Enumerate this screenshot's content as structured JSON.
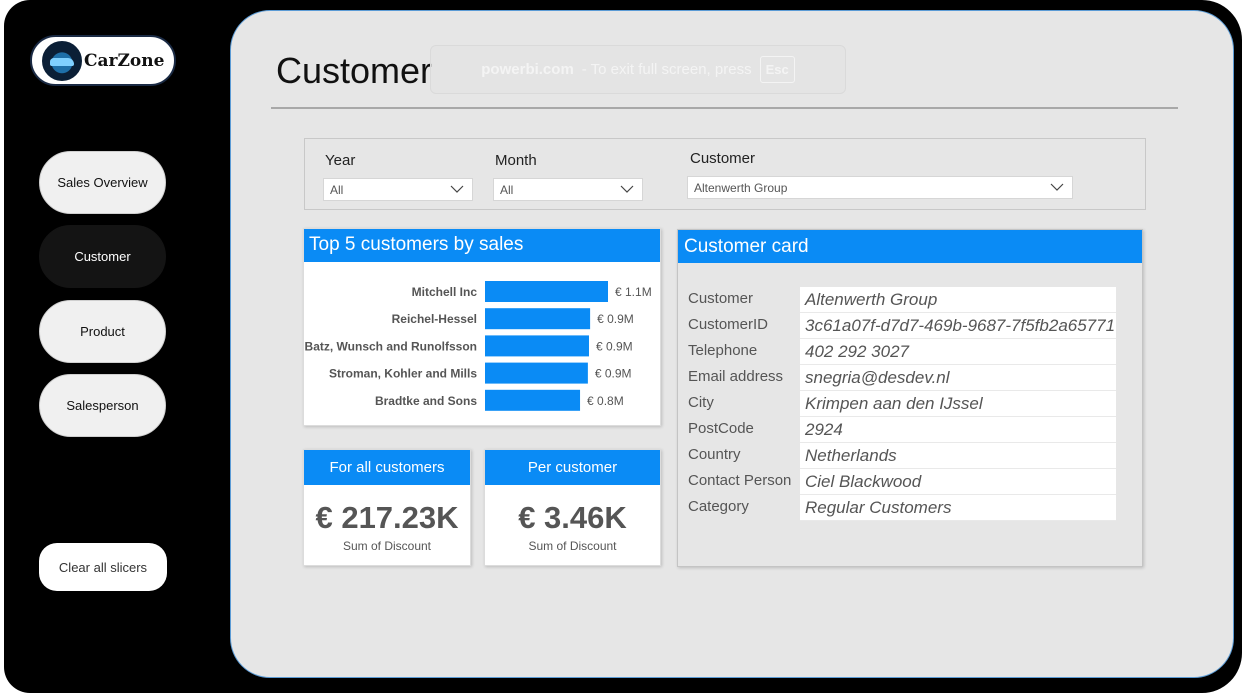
{
  "brand": {
    "name": "CarZone"
  },
  "nav": {
    "items": [
      {
        "label": "Sales Overview"
      },
      {
        "label": "Customer"
      },
      {
        "label": "Product"
      },
      {
        "label": "Salesperson"
      }
    ],
    "clear_label": "Clear all slicers"
  },
  "page": {
    "title": "Customer"
  },
  "fullscreen_toast": {
    "site": "powerbi.com",
    "message": "-  To exit full screen, press",
    "key": "Esc"
  },
  "filters": {
    "year": {
      "label": "Year",
      "value": "All"
    },
    "month": {
      "label": "Month",
      "value": "All"
    },
    "customer": {
      "label": "Customer",
      "value": "Altenwerth Group"
    }
  },
  "top5": {
    "title": "Top 5 customers by sales",
    "bar_color": "#0a8bf5",
    "chart_data": {
      "type": "bar",
      "orientation": "horizontal",
      "categories": [
        "Mitchell Inc",
        "Reichel-Hessel",
        "Batz, Wunsch and Runolfsson",
        "Stroman, Kohler and Mills",
        "Bradtke and Sons"
      ],
      "values": [
        1.1,
        0.94,
        0.93,
        0.92,
        0.85
      ],
      "labels": [
        "€ 1.1M",
        "€ 0.9M",
        "€ 0.9M",
        "€ 0.9M",
        "€ 0.8M"
      ],
      "unit": "€ M",
      "xlim": [
        0,
        1.1
      ]
    }
  },
  "kpis": [
    {
      "title": "For all customers",
      "value": "€ 217.23K",
      "subtitle": "Sum of Discount"
    },
    {
      "title": "Per customer",
      "value": "€ 3.46K",
      "subtitle": "Sum of Discount"
    }
  ],
  "customer_card": {
    "title": "Customer card",
    "rows": [
      {
        "label": "Customer",
        "value": "Altenwerth Group"
      },
      {
        "label": "CustomerID",
        "value": "3c61a07f-d7d7-469b-9687-7f5fb2a65771"
      },
      {
        "label": "Telephone",
        "value": "402 292 3027"
      },
      {
        "label": "Email address",
        "value": "snegria@desdev.nl"
      },
      {
        "label": "City",
        "value": "Krimpen aan den IJssel"
      },
      {
        "label": "PostCode",
        "value": "2924"
      },
      {
        "label": "Country",
        "value": "Netherlands"
      },
      {
        "label": "Contact Person",
        "value": "Ciel Blackwood"
      },
      {
        "label": "Category",
        "value": "Regular Customers"
      }
    ]
  }
}
